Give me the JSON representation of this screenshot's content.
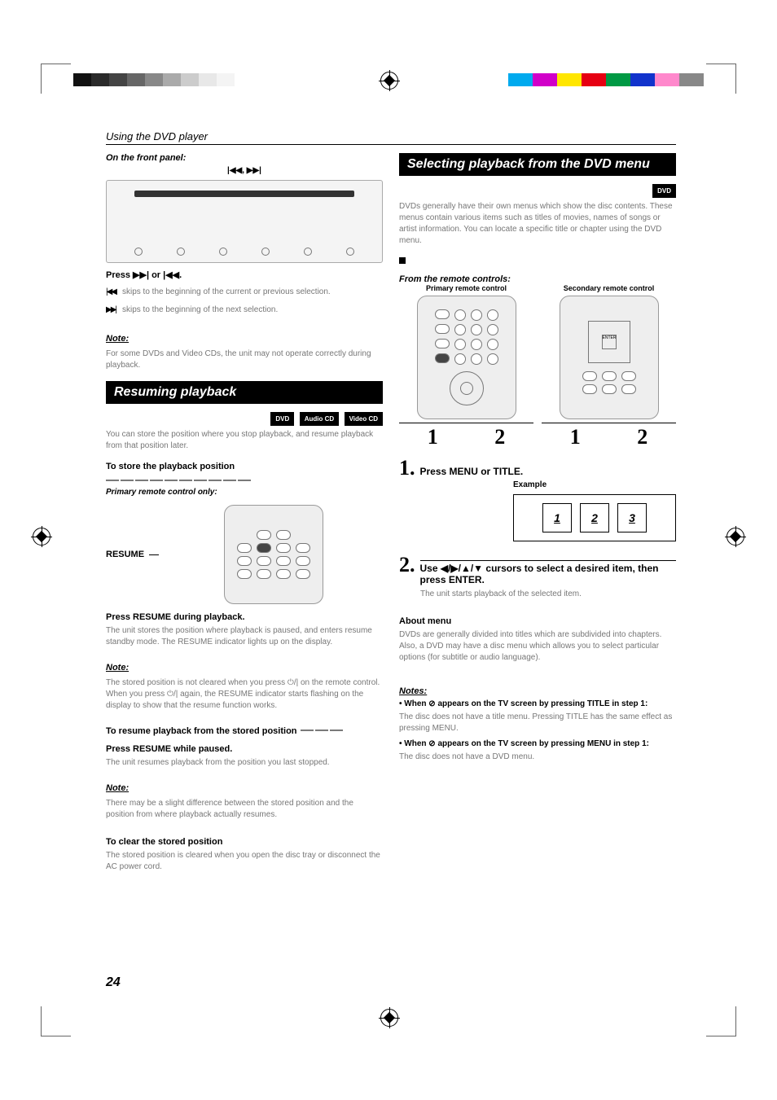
{
  "header": {
    "section": "Using the DVD player"
  },
  "left": {
    "front_panel": "On the front panel:",
    "panel_caption": "|◀◀, ▶▶|",
    "press_or": "Press ▶▶| or |◀◀.",
    "press_sub1": "|◀◀",
    "press_sub1_t": "skips to the beginning of the current or previous selection.",
    "press_sub2": "▶▶|",
    "press_sub2_t": "skips to the beginning of the next selection.",
    "note1_h": "Note:",
    "note1_t": "For some DVDs and Video CDs, the unit may not operate correctly during playback.",
    "bar_resume": "Resuming playback",
    "badges": {
      "dvd": "DVD",
      "acd": "Audio CD",
      "vcd": "Video CD"
    },
    "resume_intro": "You can store the position where you stop playback, and resume playback from that position later.",
    "store_h": "To store the playback position",
    "primary_only": "Primary remote control only:",
    "resume_label": "RESUME",
    "press_resume": "Press RESUME during playback.",
    "press_resume_t": "The unit stores the position where playback is paused, and enters resume standby mode. The RESUME indicator lights up on the display.",
    "note2_h": "Note:",
    "note2_t1": "The stored position is not cleared when you press ",
    "note2_t2": " on the remote control. When you press ",
    "note2_t3": " again, the RESUME indicator starts flashing on the display to show that the resume function works.",
    "resume_from_h": "To resume playback from the stored position",
    "press_while": "Press RESUME while paused.",
    "press_while_t": "The unit resumes playback from the position you last stopped.",
    "note3_h": "Note:",
    "note3_t": "There may be a slight difference between the stored position and the position from where playback actually resumes.",
    "clear_h": "To clear the stored position",
    "clear_t": "The stored position is cleared when you open the disc tray or disconnect the AC power cord."
  },
  "right": {
    "bar_sel": "Selecting playback from the DVD menu",
    "badge_dvd": "DVD",
    "intro": "DVDs generally have their own menus which show the disc contents. These menus contain various items such as titles of movies, names of songs or artist information. You can locate a specific title or chapter using the DVD menu.",
    "from_remote": "From the remote controls:",
    "primary": "Primary remote control",
    "secondary": "Secondary remote control",
    "numline": {
      "a1": "1",
      "a2": "2",
      "b1": "1",
      "b2": "2"
    },
    "step1_n": "1.",
    "step1_t": "Press MENU or TITLE.",
    "example_h": "Example",
    "example": {
      "c1": "1",
      "c2": "2",
      "c3": "3"
    },
    "step2_n": "2.",
    "step2_t": "Use ◀/▶/▲/▼ cursors to select a desired item, then press ENTER.",
    "step2_sub": "The unit starts playback of the selected item.",
    "about_h": "About menu",
    "about_t": "DVDs are generally divided into titles which are subdivided into chapters. Also, a DVD may have a disc menu which allows you to select particular options (for subtitle or audio language).",
    "notes_h": "Notes:",
    "notes1a": "• When ",
    "notes1b": " appears on the TV screen by pressing TITLE in step 1:",
    "notes1c": "The disc does not have a title menu. Pressing TITLE has the same effect as pressing MENU.",
    "notes2a": "• When ",
    "notes2b": " appears on the TV screen by pressing MENU in step 1:",
    "notes2c": "The disc does not have a DVD menu."
  },
  "page_number": "24"
}
